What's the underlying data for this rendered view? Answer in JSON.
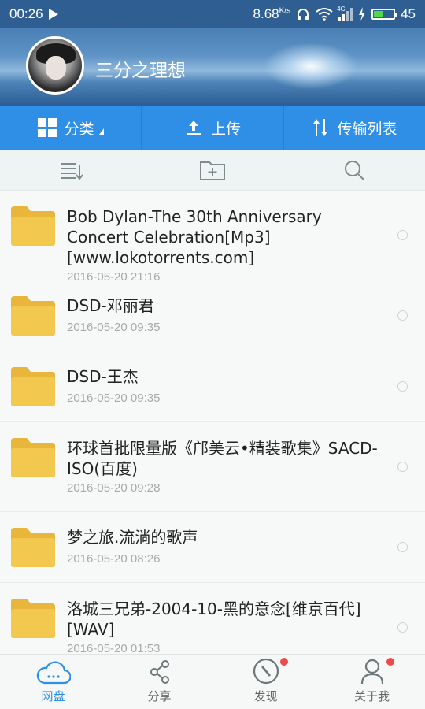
{
  "status_bar": {
    "time": "00:26",
    "speed": "8.68",
    "speed_unit": "K/s",
    "network": "4G",
    "battery": "45",
    "battery_level": 0.45
  },
  "header": {
    "username": "三分之理想"
  },
  "actions": [
    {
      "label": "分类",
      "icon": "grid-icon"
    },
    {
      "label": "上传",
      "icon": "upload-icon"
    },
    {
      "label": "传输列表",
      "icon": "transfer-icon"
    }
  ],
  "toolbar": {
    "icons": [
      "sort-list-icon",
      "new-folder-icon",
      "search-icon"
    ]
  },
  "files": [
    {
      "name": "Bob Dylan-The 30th Anniversary Concert Celebration[Mp3][www.lokotorrents.com]",
      "date": "2016-05-20  21:16"
    },
    {
      "name": "DSD-邓丽君",
      "date": "2016-05-20  09:35"
    },
    {
      "name": "DSD-王杰",
      "date": "2016-05-20  09:35"
    },
    {
      "name": "环球首批限量版《邝美云•精装歌集》SACD-ISO(百度)",
      "date": "2016-05-20  09:28"
    },
    {
      "name": "梦之旅.流淌的歌声",
      "date": "2016-05-20  08:26"
    },
    {
      "name": "洛城三兄弟-2004-10-黑的意念[维京百代][WAV]",
      "date": "2016-05-20  01:53"
    }
  ],
  "bottom_nav": [
    {
      "label": "网盘",
      "icon": "cloud-icon",
      "active": true
    },
    {
      "label": "分享",
      "icon": "share-icon"
    },
    {
      "label": "发现",
      "icon": "compass-icon",
      "badge": true
    },
    {
      "label": "关于我",
      "icon": "person-icon",
      "badge": true
    }
  ],
  "colors": {
    "accent": "#2f8fe6",
    "folder": "#f1c34a",
    "badge": "#ef4a4a"
  }
}
